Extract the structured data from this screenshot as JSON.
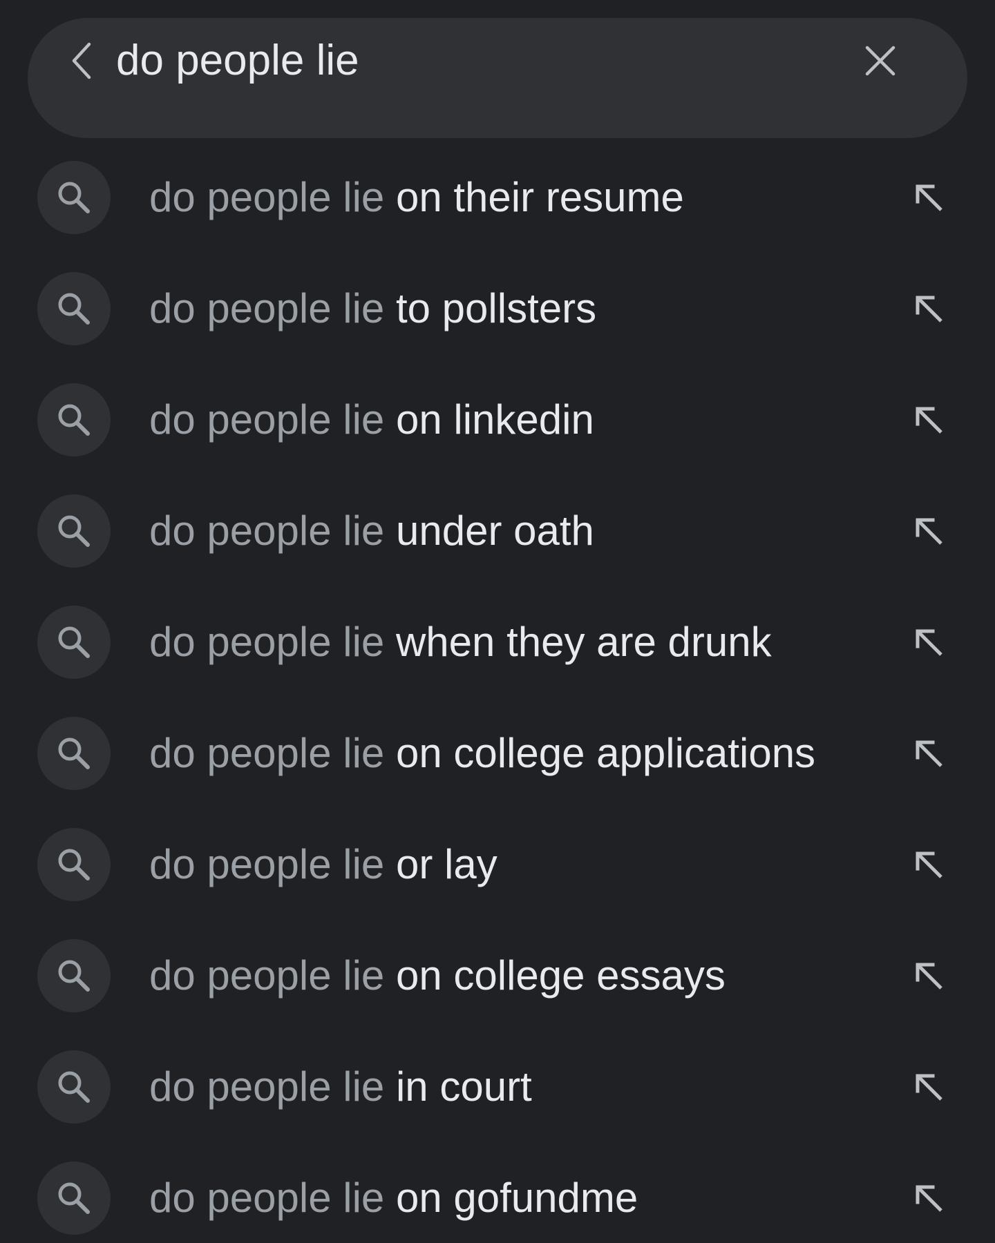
{
  "colors": {
    "background": "#202124",
    "surface": "#303134",
    "text_primary": "#e8eaed",
    "text_secondary": "#9aa0a6"
  },
  "search_bar": {
    "back_icon": "chevron-left-icon",
    "query": "do people lie",
    "clear_icon": "close-icon"
  },
  "suggestions": [
    {
      "prefix": "do people lie",
      "completion": "on their resume",
      "icon": "search-icon",
      "action_icon": "arrow-up-left-icon"
    },
    {
      "prefix": "do people lie",
      "completion": "to pollsters",
      "icon": "search-icon",
      "action_icon": "arrow-up-left-icon"
    },
    {
      "prefix": "do people lie",
      "completion": "on linkedin",
      "icon": "search-icon",
      "action_icon": "arrow-up-left-icon"
    },
    {
      "prefix": "do people lie",
      "completion": "under oath",
      "icon": "search-icon",
      "action_icon": "arrow-up-left-icon"
    },
    {
      "prefix": "do people lie",
      "completion": "when they are drunk",
      "icon": "search-icon",
      "action_icon": "arrow-up-left-icon"
    },
    {
      "prefix": "do people lie",
      "completion": "on college applications",
      "icon": "search-icon",
      "action_icon": "arrow-up-left-icon"
    },
    {
      "prefix": "do people lie",
      "completion": "or lay",
      "icon": "search-icon",
      "action_icon": "arrow-up-left-icon"
    },
    {
      "prefix": "do people lie",
      "completion": "on college essays",
      "icon": "search-icon",
      "action_icon": "arrow-up-left-icon"
    },
    {
      "prefix": "do people lie",
      "completion": "in court",
      "icon": "search-icon",
      "action_icon": "arrow-up-left-icon"
    },
    {
      "prefix": "do people lie",
      "completion": "on gofundme",
      "icon": "search-icon",
      "action_icon": "arrow-up-left-icon"
    }
  ]
}
